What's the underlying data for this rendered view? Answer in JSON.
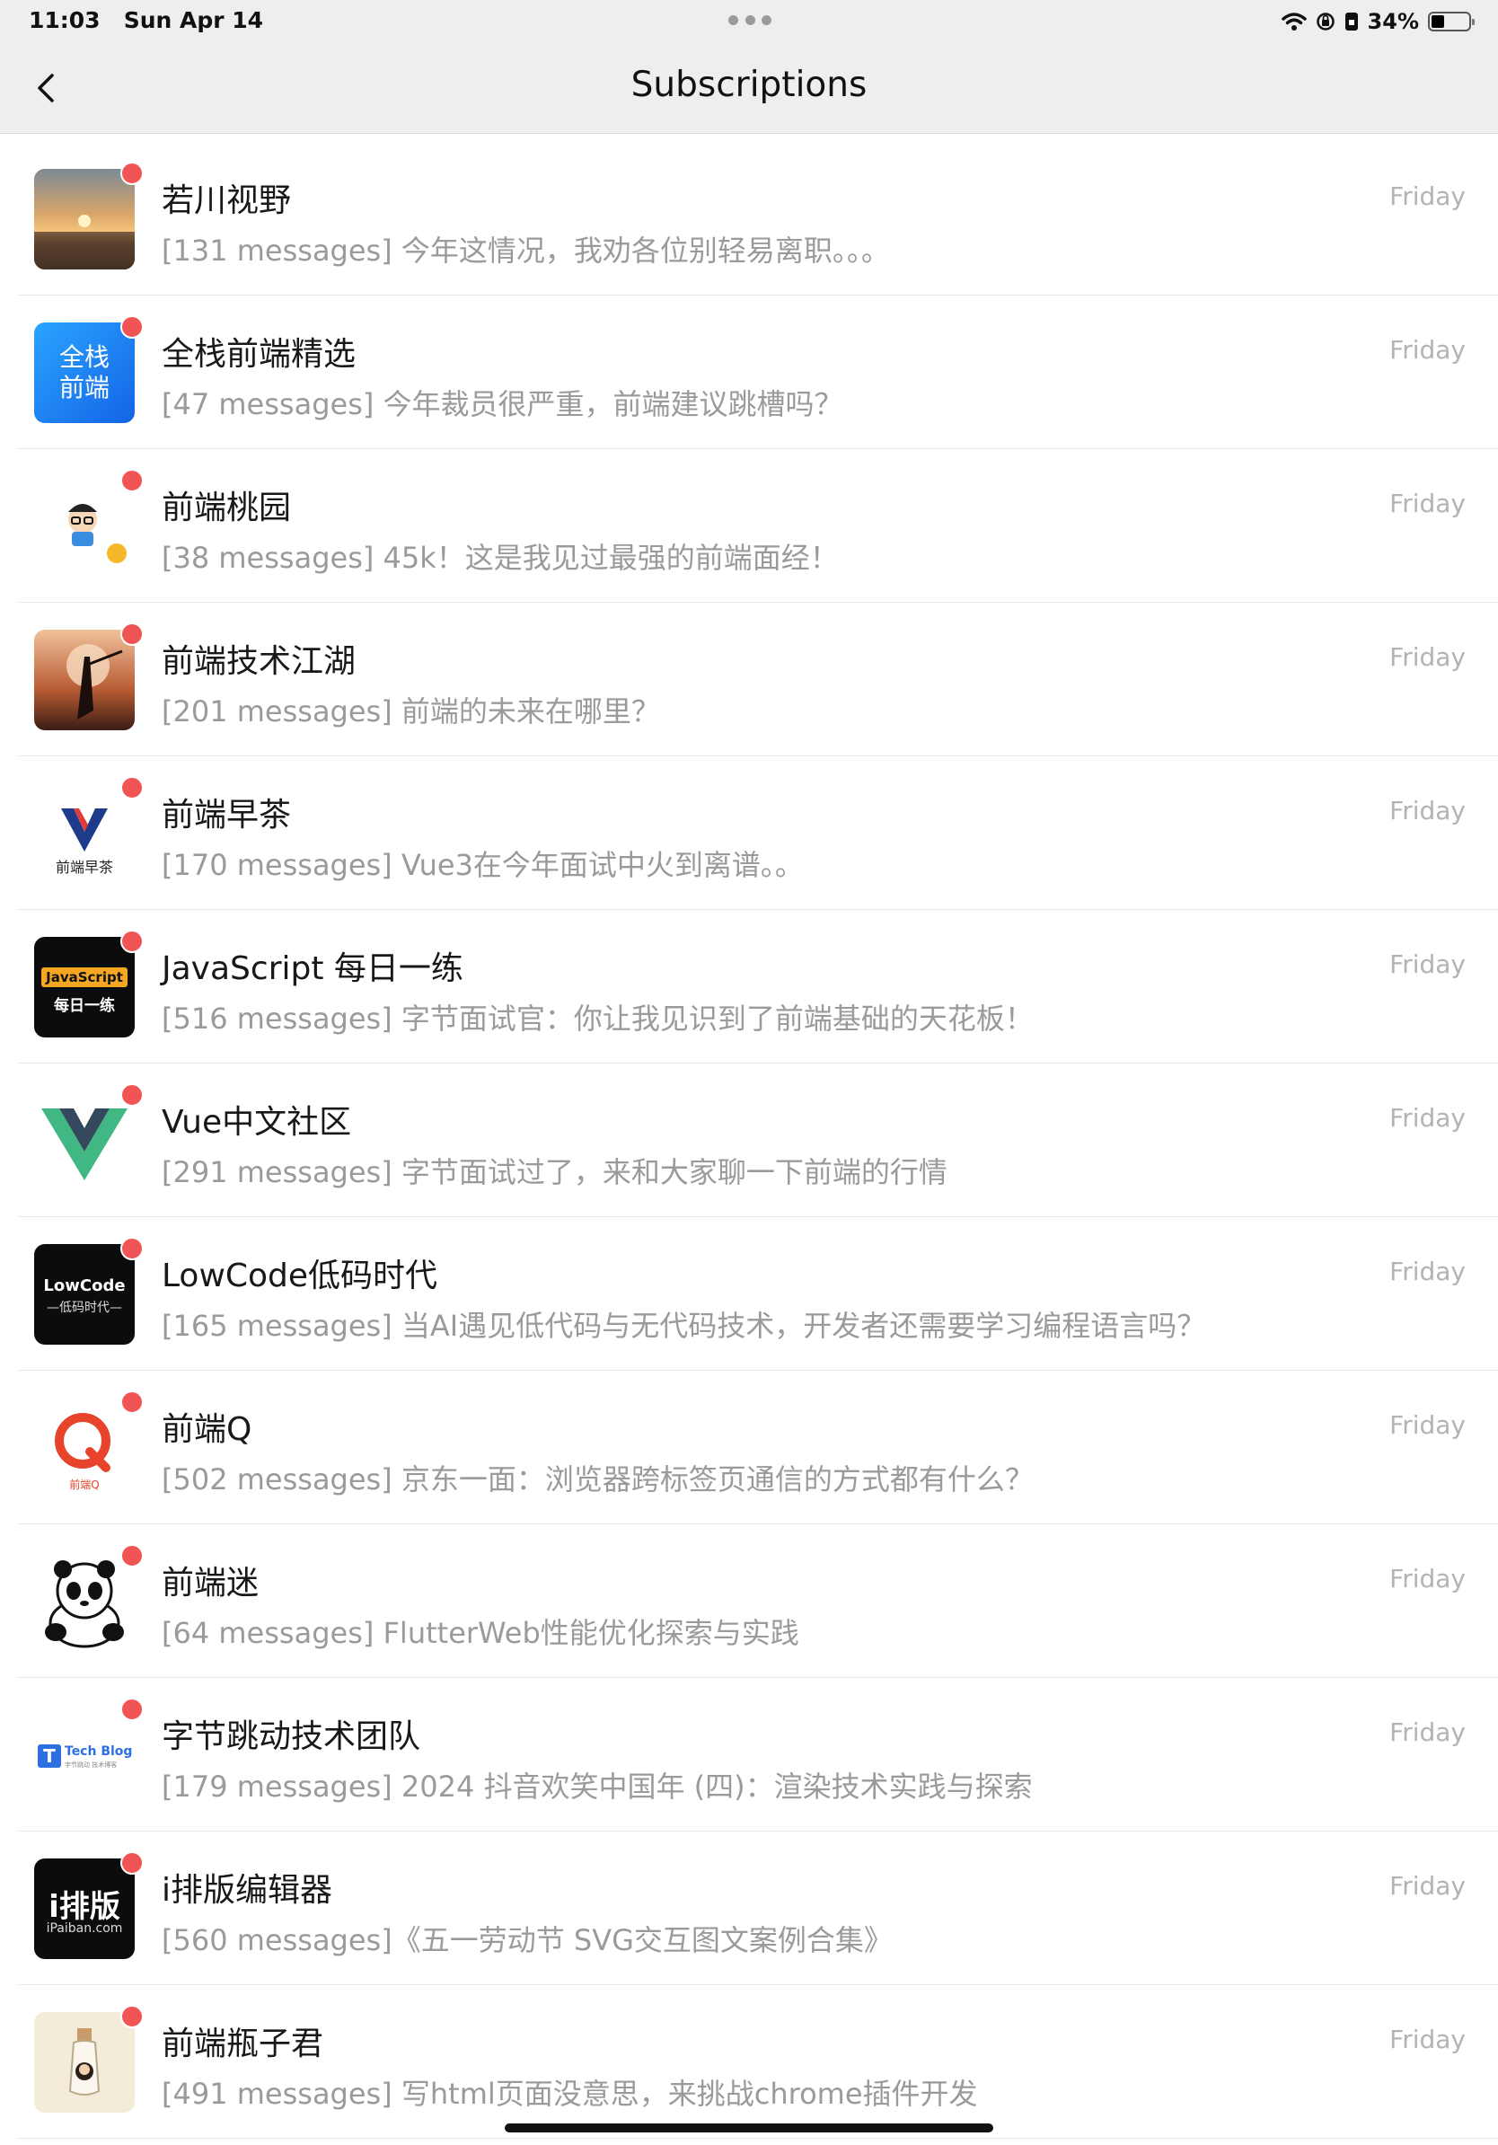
{
  "status": {
    "time": "11:03",
    "date": "Sun Apr 14",
    "battery": "34%",
    "battery_level": 0.34
  },
  "header": {
    "title": "Subscriptions"
  },
  "items": [
    {
      "name": "若川视野",
      "preview": "[131 messages] 今年这情况，我劝各位别轻易离职。。。",
      "time": "Friday",
      "avatar": "sunset"
    },
    {
      "name": "全栈前端精选",
      "preview": "[47 messages] 今年裁员很严重，前端建议跳槽吗？",
      "time": "Friday",
      "avatar": "blue",
      "avatar_text": "全栈 前端"
    },
    {
      "name": "前端桃园",
      "preview": "[38 messages] 45k！这是我见过最强的前端面经！",
      "time": "Friday",
      "avatar": "cartoon"
    },
    {
      "name": "前端技术江湖",
      "preview": "[201 messages] 前端的未来在哪里？",
      "time": "Friday",
      "avatar": "warrior"
    },
    {
      "name": "前端早茶",
      "preview": "[170 messages] Vue3在今年面试中火到离谱。。",
      "time": "Friday",
      "avatar": "zaocha",
      "avatar_text": "前端早茶"
    },
    {
      "name": "JavaScript 每日一练",
      "preview": "[516 messages] 字节面试官：你让我见识到了前端基础的天花板！",
      "time": "Friday",
      "avatar": "js",
      "avatar_text": "JavaScript",
      "avatar_text2": "每日一练"
    },
    {
      "name": "Vue中文社区",
      "preview": "[291 messages] 字节面试过了，来和大家聊一下前端的行情",
      "time": "Friday",
      "avatar": "vue"
    },
    {
      "name": "LowCode低码时代",
      "preview": "[165 messages] 当AI遇见低代码与无代码技术，开发者还需要学习编程语言吗？",
      "time": "Friday",
      "avatar": "lowcode",
      "avatar_text": "LowCode",
      "avatar_text2": "—低码时代—"
    },
    {
      "name": "前端Q",
      "preview": "[502 messages] 京东一面：浏览器跨标签页通信的方式都有什么？",
      "time": "Friday",
      "avatar": "q",
      "avatar_text": "前端Q"
    },
    {
      "name": "前端迷",
      "preview": "[64 messages] FlutterWeb性能优化探索与实践",
      "time": "Friday",
      "avatar": "panda"
    },
    {
      "name": "字节跳动技术团队",
      "preview": "[179 messages] 2024 抖音欢笑中国年 (四)：渲染技术实践与探索",
      "time": "Friday",
      "avatar": "techblog",
      "avatar_text": "Tech Blog",
      "avatar_text2": "字节跳动 技术博客"
    },
    {
      "name": "i排版编辑器",
      "preview": "[560 messages]《五一劳动节 SVG交互图文案例合集》",
      "time": "Friday",
      "avatar": "ipaiban",
      "avatar_text": "i排版",
      "avatar_text2": "iPaiban.com"
    },
    {
      "name": "前端瓶子君",
      "preview": "[491 messages] 写html页面没意思，来挑战chrome插件开发",
      "time": "Friday",
      "avatar": "bottle"
    }
  ]
}
